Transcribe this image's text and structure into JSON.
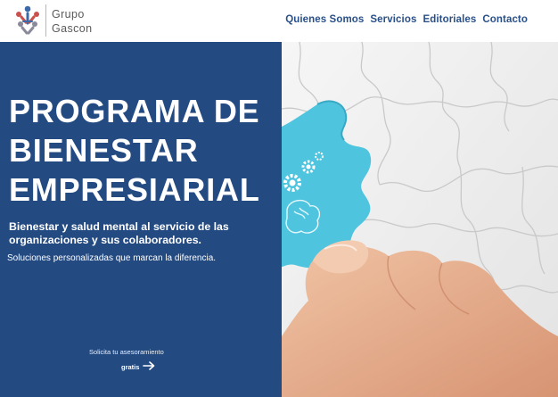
{
  "brand": {
    "line1": "Grupo",
    "line2": "Gascon"
  },
  "nav": {
    "items": [
      "Quienes Somos",
      "Servicios",
      "Editoriales",
      "Contacto"
    ]
  },
  "hero": {
    "title_lines": [
      "PROGRAMA DE",
      "BIENESTAR",
      "EMPRESIARIAL"
    ],
    "subtitle": "Bienestar y salud mental al servicio de las organizaciones y sus colaboradores.",
    "description": "Soluciones personalizadas que marcan la diferencia.",
    "cta_label": "Solicita tu asesoramiento",
    "cta_link": "gratis"
  },
  "colors": {
    "primary_blue": "#244a82",
    "nav_blue": "#2a5089",
    "puzzle_cyan": "#4ec4de",
    "logo_red": "#c9524f",
    "logo_gray": "#8a8a9a",
    "logo_blue": "#3b6aa8"
  },
  "icons": {
    "cta_arrow": "arrow-right-icon",
    "logo": "people-logo-icon"
  }
}
